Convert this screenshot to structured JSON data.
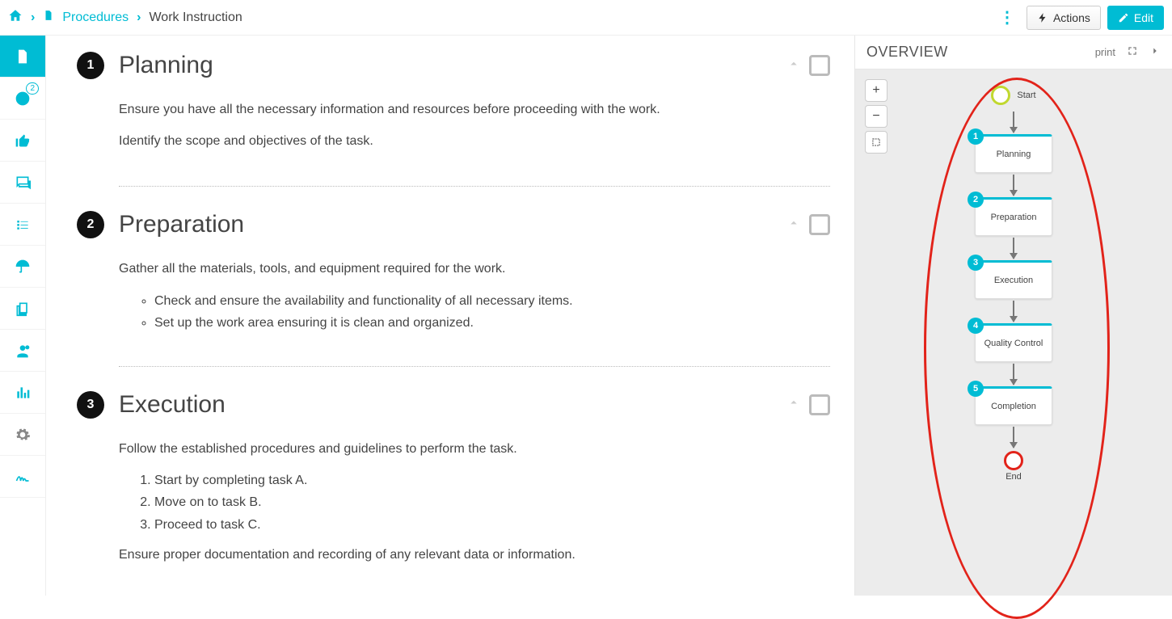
{
  "breadcrumb": {
    "parent": "Procedures",
    "current": "Work Instruction"
  },
  "topbar": {
    "actions_label": "Actions",
    "edit_label": "Edit"
  },
  "sidebar": {
    "badge": "2"
  },
  "steps": [
    {
      "num": "1",
      "title": "Planning",
      "paras": [
        "Ensure you have all the necessary information and resources before proceeding with the work.",
        "Identify the scope and objectives of the task."
      ],
      "ul": [],
      "ol": [],
      "trailing": ""
    },
    {
      "num": "2",
      "title": "Preparation",
      "paras": [
        "Gather all the materials, tools, and equipment required for the work."
      ],
      "ul": [
        "Check and ensure the availability and functionality of all necessary items.",
        "Set up the work area ensuring it is clean and organized."
      ],
      "ol": [],
      "trailing": ""
    },
    {
      "num": "3",
      "title": "Execution",
      "paras": [
        "Follow the established procedures and guidelines to perform the task."
      ],
      "ul": [],
      "ol": [
        "Start by completing task A.",
        "Move on to task B.",
        "Proceed to task C."
      ],
      "trailing": "Ensure proper documentation and recording of any relevant data or information."
    }
  ],
  "overview": {
    "title": "OVERVIEW",
    "print": "print",
    "start": "Start",
    "end": "End",
    "nodes": [
      {
        "num": "1",
        "label": "Planning"
      },
      {
        "num": "2",
        "label": "Preparation"
      },
      {
        "num": "3",
        "label": "Execution"
      },
      {
        "num": "4",
        "label": "Quality Control"
      },
      {
        "num": "5",
        "label": "Completion"
      }
    ],
    "zoom": {
      "plus": "+",
      "minus": "−",
      "fit": "⛶"
    }
  }
}
